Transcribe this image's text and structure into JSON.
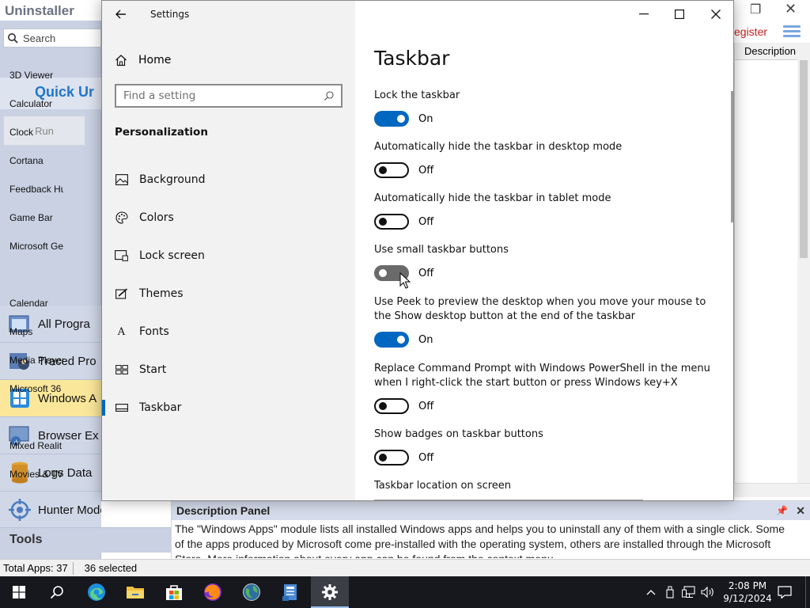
{
  "background_app": {
    "title": "Uninstaller",
    "search_placeholder": "Search",
    "quick_title": "Quick Ur",
    "run_label": "Run",
    "register_label": "egister",
    "nav": [
      {
        "label": "All Progra",
        "icon": "window-stack-icon"
      },
      {
        "label": "Traced Pro",
        "icon": "tracer-icon"
      },
      {
        "label": "Windows A",
        "icon": "windows-logo-icon",
        "active": true
      },
      {
        "label": "Browser Ex",
        "icon": "browser-extension-icon"
      },
      {
        "label": "Logs Data",
        "icon": "database-icon"
      },
      {
        "label": "Hunter Mode",
        "icon": "crosshair-icon"
      }
    ],
    "tools_label": "Tools",
    "list_header": "Description",
    "list_items": [
      "3D Viewer",
      "Calculator",
      "Clock",
      "Cortana",
      "Feedback Hu",
      "Game Bar",
      "Microsoft Ge",
      "Calendar",
      "Maps",
      "Media Player",
      "Microsoft 36",
      "Mixed Realit",
      "Movies & TV"
    ],
    "description_panel": {
      "title": "Description Panel",
      "text": "The \"Windows Apps\" module lists all installed Windows apps and helps you to uninstall any of them with a single click. Some of the apps produced by Microsoft  come pre-installed with the operating system, others are installed through the Microsoft Store. More information about every app can be found from the context menu."
    },
    "status": {
      "total": "Total Apps: 37",
      "selected": "36 selected"
    }
  },
  "settings": {
    "window_title": "Settings",
    "home_label": "Home",
    "find_placeholder": "Find a setting",
    "group_title": "Personalization",
    "nav": [
      {
        "label": "Background",
        "icon": "picture-icon"
      },
      {
        "label": "Colors",
        "icon": "palette-icon"
      },
      {
        "label": "Lock screen",
        "icon": "lock-screen-icon"
      },
      {
        "label": "Themes",
        "icon": "brush-icon"
      },
      {
        "label": "Fonts",
        "icon": "font-icon"
      },
      {
        "label": "Start",
        "icon": "start-tiles-icon"
      },
      {
        "label": "Taskbar",
        "icon": "taskbar-icon",
        "selected": true
      }
    ],
    "page_title": "Taskbar",
    "options": [
      {
        "label": "Lock the taskbar",
        "state": "On"
      },
      {
        "label": "Automatically hide the taskbar in desktop mode",
        "state": "Off"
      },
      {
        "label": "Automatically hide the taskbar in tablet mode",
        "state": "Off"
      },
      {
        "label": "Use small taskbar buttons",
        "state": "Off"
      },
      {
        "label": "Use Peek to preview the desktop when you move your mouse to the Show desktop button at the end of the taskbar",
        "state": "On"
      },
      {
        "label": "Replace Command Prompt with Windows PowerShell in the menu when I right-click the start button or press Windows key+X",
        "state": "Off"
      },
      {
        "label": "Show badges on taskbar buttons",
        "state": "Off"
      }
    ],
    "location_label": "Taskbar location on screen"
  },
  "taskbar": {
    "time": "2:08 PM",
    "date": "9/12/2024"
  },
  "colors": {
    "accent": "#0067c0",
    "taskbar": "#16181d",
    "sidebar": "#f2f2f2"
  }
}
